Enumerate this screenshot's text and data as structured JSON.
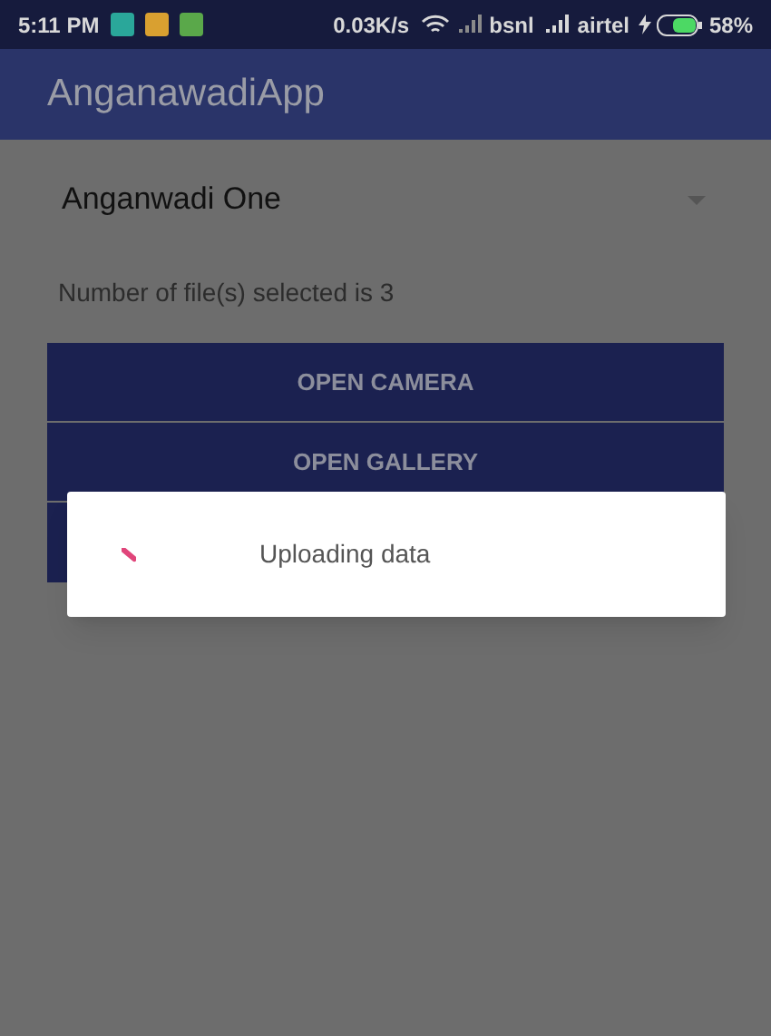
{
  "status_bar": {
    "time": "5:11 PM",
    "speed": "0.03K/s",
    "carrier_1": "bsnl",
    "carrier_2": "airtel",
    "battery": "58%"
  },
  "app_bar": {
    "title": "AnganawadiApp"
  },
  "spinner": {
    "value": "Anganwadi One"
  },
  "selection_text": "Number of file(s) selected is 3",
  "buttons": [
    {
      "label": "OPEN CAMERA"
    },
    {
      "label": "OPEN GALLERY"
    }
  ],
  "dialog": {
    "message": "Uploading data"
  }
}
